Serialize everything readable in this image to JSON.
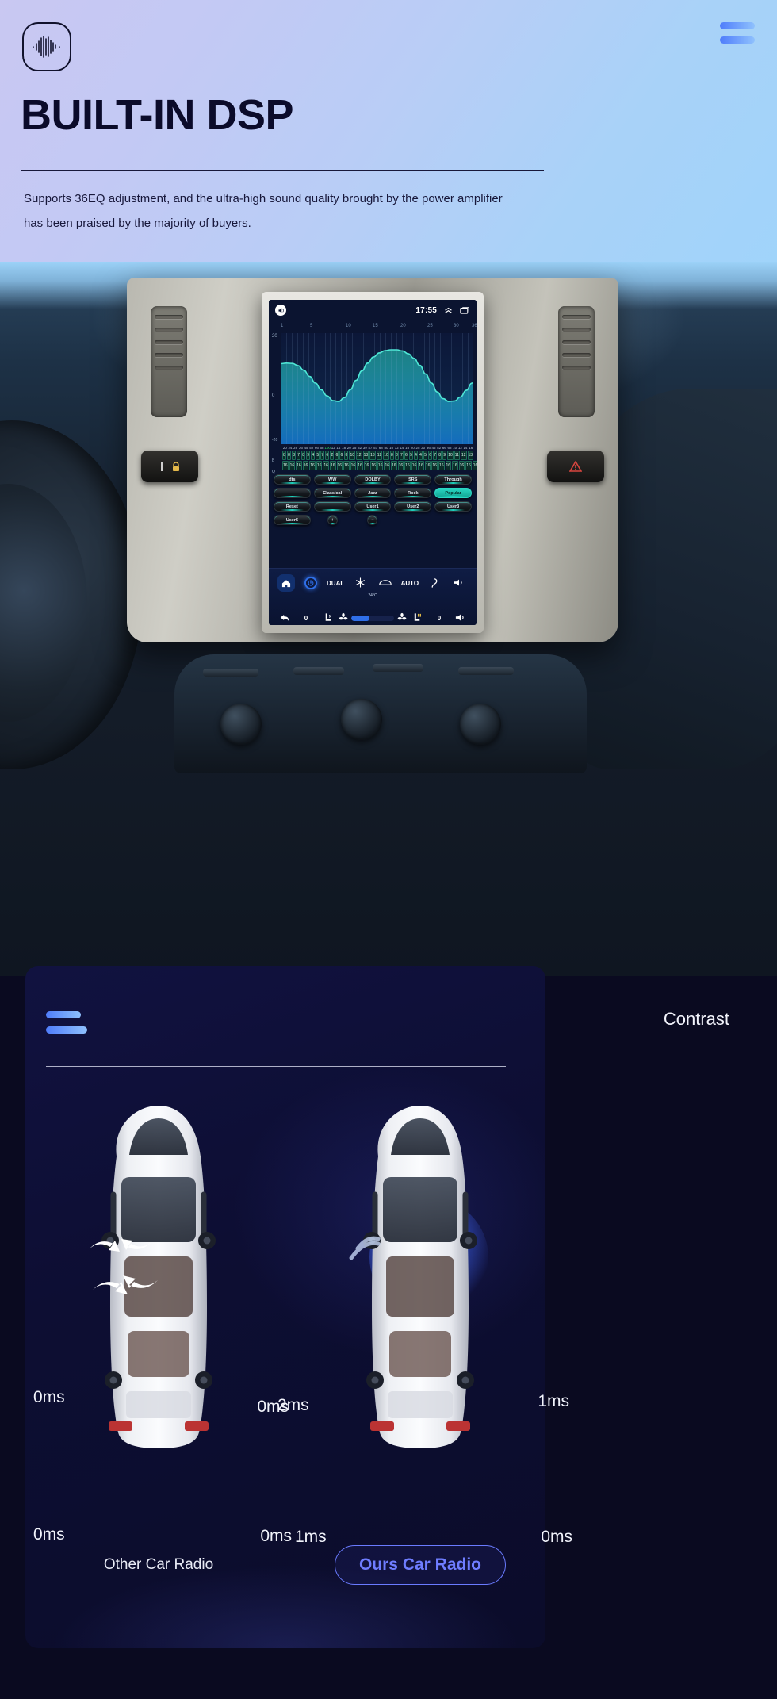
{
  "hero": {
    "logo_icon": "audio-waveform-icon",
    "menu_icon": "hamburger-menu-icon",
    "title": "BUILT-IN DSP",
    "description": "Supports 36EQ adjustment, and the ultra-high sound quality brought by the power amplifier has been praised by the majority of buyers."
  },
  "radio": {
    "status": {
      "mute_icon": "speaker-mute-icon",
      "time": "17:55",
      "collapse_icon": "chevron-up-icon",
      "windows_icon": "recent-apps-icon"
    },
    "eq": {
      "x_ticks": [
        "1",
        "5",
        "10",
        "15",
        "20",
        "25",
        "30",
        "36"
      ],
      "y_top": "20",
      "y_mid": "0",
      "y_bottom": "-20",
      "curve_points": [
        9,
        9.2,
        9.1,
        8.3,
        6.6,
        4.4,
        2.0,
        -0.4,
        -2.6,
        -4.3,
        -4.6,
        -3.2,
        -0.4,
        3.0,
        6.4,
        9.2,
        11.4,
        12.9,
        13.7,
        14.0,
        14.0,
        13.6,
        12.6,
        10.9,
        8.4,
        5.3,
        2.0,
        -1.2,
        -3.6,
        -4.6,
        -4.4,
        -3.0,
        -0.6,
        2.0,
        4.3,
        5.6
      ]
    },
    "bands": {
      "frequencies": [
        "20",
        "24",
        "29",
        "36",
        "45",
        "52",
        "66",
        "68",
        "100",
        "12",
        "14",
        "18",
        "20",
        "25",
        "32",
        "39",
        "47",
        "57",
        "68",
        "80",
        "10",
        "12",
        "14",
        "16",
        "20",
        "25",
        "30",
        "36",
        "45",
        "52",
        "66",
        "68",
        "10",
        "12",
        "14",
        "16"
      ],
      "highlight_index": 8,
      "row1_label": "B",
      "row2_label": "Q",
      "row1": [
        "8",
        "8",
        "8",
        "7",
        "8",
        "9",
        "4",
        "5",
        "7",
        "6",
        "2",
        "6",
        "6",
        "8",
        "10",
        "12",
        "13",
        "13",
        "12",
        "10",
        "8",
        "8",
        "7",
        "6",
        "5",
        "4",
        "4",
        "5",
        "6",
        "7",
        "8",
        "9",
        "10",
        "11",
        "12",
        "13"
      ],
      "row2": [
        "16",
        "16",
        "16",
        "16",
        "16",
        "16",
        "16",
        "16",
        "16",
        "16",
        "16",
        "16",
        "16",
        "16",
        "16",
        "16",
        "16",
        "16",
        "16",
        "16",
        "16",
        "16",
        "16",
        "16",
        "16",
        "16",
        "16",
        "16",
        "16",
        "16",
        "16",
        "16",
        "16",
        "16",
        "16",
        "16"
      ]
    },
    "presets": [
      {
        "label": "dts",
        "icon": "dts-logo-icon",
        "active": false
      },
      {
        "label": "WW",
        "icon": "ww-logo-icon",
        "active": false
      },
      {
        "label": "DOLBY",
        "icon": "dolby-logo-icon",
        "active": false
      },
      {
        "label": "SRS",
        "icon": "srs-logo-icon",
        "active": false
      },
      {
        "label": "Through",
        "icon": "",
        "active": false
      },
      {
        "label": "",
        "icon": "balance-icon",
        "active": false
      },
      {
        "label": "Classical",
        "icon": "",
        "active": false
      },
      {
        "label": "Jazz",
        "icon": "",
        "active": false
      },
      {
        "label": "Rock",
        "icon": "",
        "active": false
      },
      {
        "label": "Popular",
        "icon": "",
        "active": true
      },
      {
        "label": "Reset",
        "icon": "",
        "active": false
      },
      {
        "label": "",
        "icon": "info-icon",
        "active": false
      },
      {
        "label": "User1",
        "icon": "",
        "active": false
      },
      {
        "label": "User2",
        "icon": "",
        "active": false
      },
      {
        "label": "User3",
        "icon": "",
        "active": false
      },
      {
        "label": "User5",
        "icon": "",
        "active": false
      },
      {
        "label": "+",
        "icon": "plus-icon",
        "active": false
      },
      {
        "label": "−",
        "icon": "minus-icon",
        "active": false
      }
    ],
    "climate": {
      "home_icon": "home-icon",
      "power_icon": "power-icon",
      "dual_label": "DUAL",
      "ac_icon": "snowflake-icon",
      "defrost_icon": "rear-defrost-icon",
      "auto_label": "AUTO",
      "airflow_icon": "airflow-icon",
      "volume_icon": "volume-up-icon",
      "temperature": "24°C",
      "back_icon": "back-arrow-icon",
      "left_temp": "0",
      "seat_icon": "seat-airflow-icon",
      "fan_left_icon": "fan-icon",
      "fan_right_icon": "fan-icon",
      "heated_seat_icon": "heated-seat-icon",
      "right_temp": "0",
      "volume_icon_2": "volume-up-icon"
    }
  },
  "contrast": {
    "menu_icon": "hamburger-menu-icon",
    "title": "Contrast",
    "left": {
      "label": "Other Car Radio",
      "delays": [
        "0ms",
        "0ms",
        "0ms",
        "0ms"
      ],
      "icon": "car-top-view-icon"
    },
    "right": {
      "label": "Ours Car Radio",
      "delays": [
        "2ms",
        "1ms",
        "1ms",
        "0ms"
      ],
      "icon": "car-top-view-icon",
      "highlight_icon": "sound-focus-glow-icon"
    }
  },
  "colors": {
    "accent_blue": "#6a7bff",
    "gradient_start": "#4f7dfb",
    "gradient_end": "#8fc1fd",
    "panel_bg": "#0d0e33",
    "eq_teal": "#2ad6c2"
  }
}
